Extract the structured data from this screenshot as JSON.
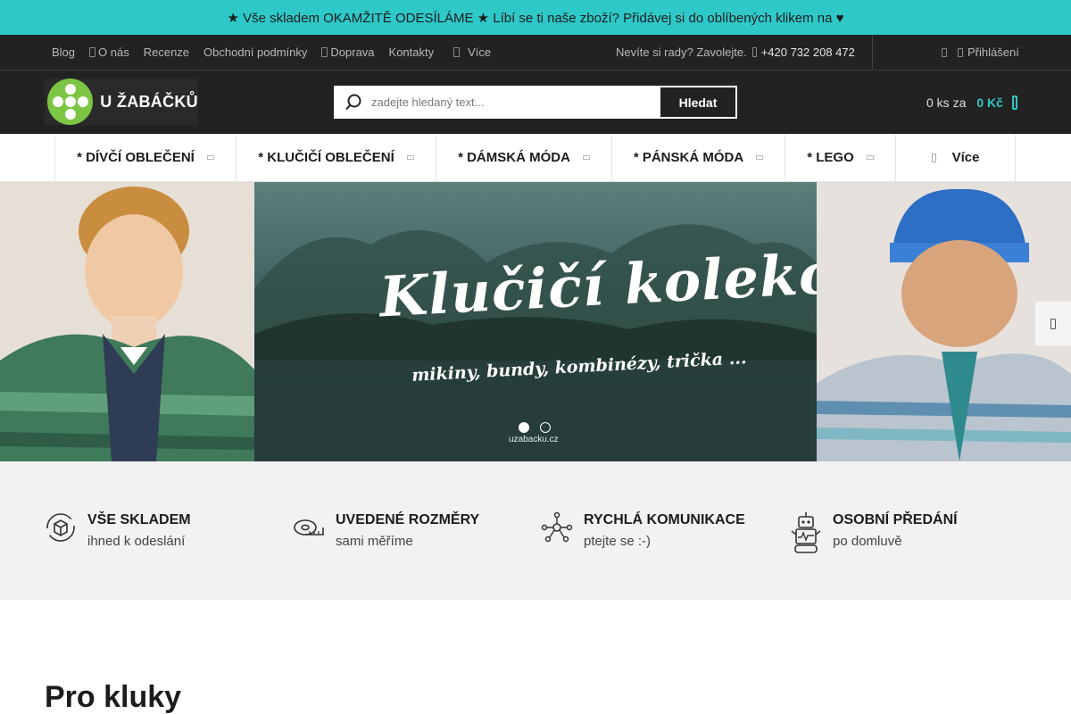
{
  "announcement": "★ Vše skladem OKAMŽITĚ ODESÍLÁME ★ Líbí se ti naše zboží? Přidávej si do oblíbených klikem na ♥",
  "topbar": {
    "links": [
      "Blog",
      "O nás",
      "Recenze",
      "Obchodní podmínky",
      "Doprava",
      "Kontakty"
    ],
    "more_label": "Více",
    "contact_prompt": "Nevíte si rady? Zavolejte.",
    "phone": "+420 732 208 472",
    "login_label": "Přihlášení"
  },
  "header": {
    "logo_text": "U ŽABÁČKŮ",
    "search_placeholder": "zadejte hledaný text...",
    "search_button": "Hledat",
    "cart_qty": "0 ks za",
    "cart_price": "0 Kč"
  },
  "categories": [
    "* DÍVČÍ OBLEČENÍ",
    "* KLUČIČÍ OBLEČENÍ",
    "* DÁMSKÁ MÓDA",
    "* PÁNSKÁ MÓDA",
    "* LEGO"
  ],
  "categories_more": "Více",
  "hero": {
    "title": "Klučičí kolekce",
    "subtitle": "mikiny, bundy, kombinézy, trička ...",
    "credit": "uzabacku.cz",
    "slide_count": 2,
    "active_slide": 1
  },
  "features": [
    {
      "title": "VŠE SKLADEM",
      "subtitle": "ihned k odeslání",
      "icon": "box-cycle-icon"
    },
    {
      "title": "UVEDENÉ ROZMĚRY",
      "subtitle": "sami měříme",
      "icon": "tape-measure-icon"
    },
    {
      "title": "RYCHLÁ KOMUNIKACE",
      "subtitle": "ptejte se :-)",
      "icon": "network-icon"
    },
    {
      "title": "OSOBNÍ PŘEDÁNÍ",
      "subtitle": "po domluvě",
      "icon": "robot-icon"
    }
  ],
  "section_title": "Pro kluky",
  "colors": {
    "accent": "#2ec8c8",
    "dark": "#222222",
    "logo_green": "#7cc443"
  }
}
